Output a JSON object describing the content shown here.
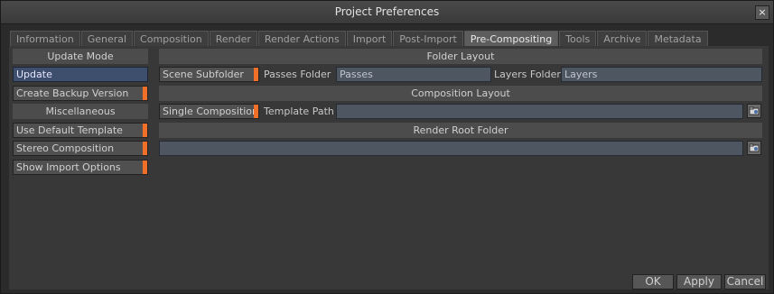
{
  "window": {
    "title": "Project Preferences",
    "close_symbol": "×"
  },
  "tabs": [
    {
      "label": "Information"
    },
    {
      "label": "General"
    },
    {
      "label": "Composition"
    },
    {
      "label": "Render"
    },
    {
      "label": "Render Actions"
    },
    {
      "label": "Import"
    },
    {
      "label": "Post-Import"
    },
    {
      "label": "Pre-Compositing",
      "active": true
    },
    {
      "label": "Tools"
    },
    {
      "label": "Archive"
    },
    {
      "label": "Metadata"
    }
  ],
  "left": {
    "update_mode_header": "Update Mode",
    "update_button": "Update",
    "create_backup": "Create Backup Version",
    "misc_header": "Miscellaneous",
    "use_default_template": "Use Default Template",
    "stereo_composition": "Stereo Composition",
    "show_import_options": "Show Import Options"
  },
  "folder_layout": {
    "header": "Folder Layout",
    "scene_subfolder": "Scene Subfolder",
    "passes_label": "Passes Folder",
    "passes_value": "Passes",
    "layers_label": "Layers Folder",
    "layers_value": "Layers"
  },
  "composition_layout": {
    "header": "Composition Layout",
    "single_composition": "Single Composition",
    "template_label": "Template Path",
    "template_value": ""
  },
  "render_root": {
    "header": "Render Root Folder",
    "value": ""
  },
  "footer": {
    "ok": "OK",
    "apply": "Apply",
    "cancel": "Cancel"
  },
  "colors": {
    "accent_orange": "#f0702a",
    "selected_blue": "#3e4e6d",
    "field_bg": "#4e5662"
  },
  "icons": {
    "browse": "folder-browse-icon",
    "close": "close-icon"
  }
}
